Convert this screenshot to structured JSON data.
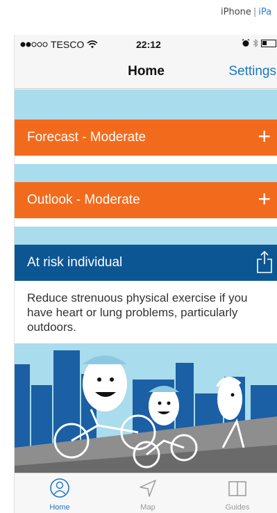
{
  "top_links": {
    "iphone": "iPhone",
    "separator": "|",
    "ipad": "iPa"
  },
  "statusbar": {
    "carrier": "TESCO",
    "time": "22:12"
  },
  "navbar": {
    "title": "Home",
    "settings_label": "Settings"
  },
  "forecast": {
    "label": "Forecast - Moderate",
    "expand_icon": "plus-icon"
  },
  "outlook": {
    "label": "Outlook - Moderate",
    "expand_icon": "plus-icon"
  },
  "risk": {
    "label": "At risk individual",
    "action_icon": "share-icon"
  },
  "advice": {
    "text": "Reduce strenuous physical exercise if you have heart or lung problems, particularly outdoors."
  },
  "tabbar": {
    "items": [
      {
        "label": "Home",
        "icon": "home-icon",
        "active": true
      },
      {
        "label": "Map",
        "icon": "map-icon",
        "active": false
      },
      {
        "label": "Guides",
        "icon": "guides-icon",
        "active": false
      }
    ]
  },
  "colors": {
    "orange": "#f26b1d",
    "navy": "#0d5694",
    "light_blue": "#a9dcec",
    "link_blue": "#1a78c2"
  }
}
